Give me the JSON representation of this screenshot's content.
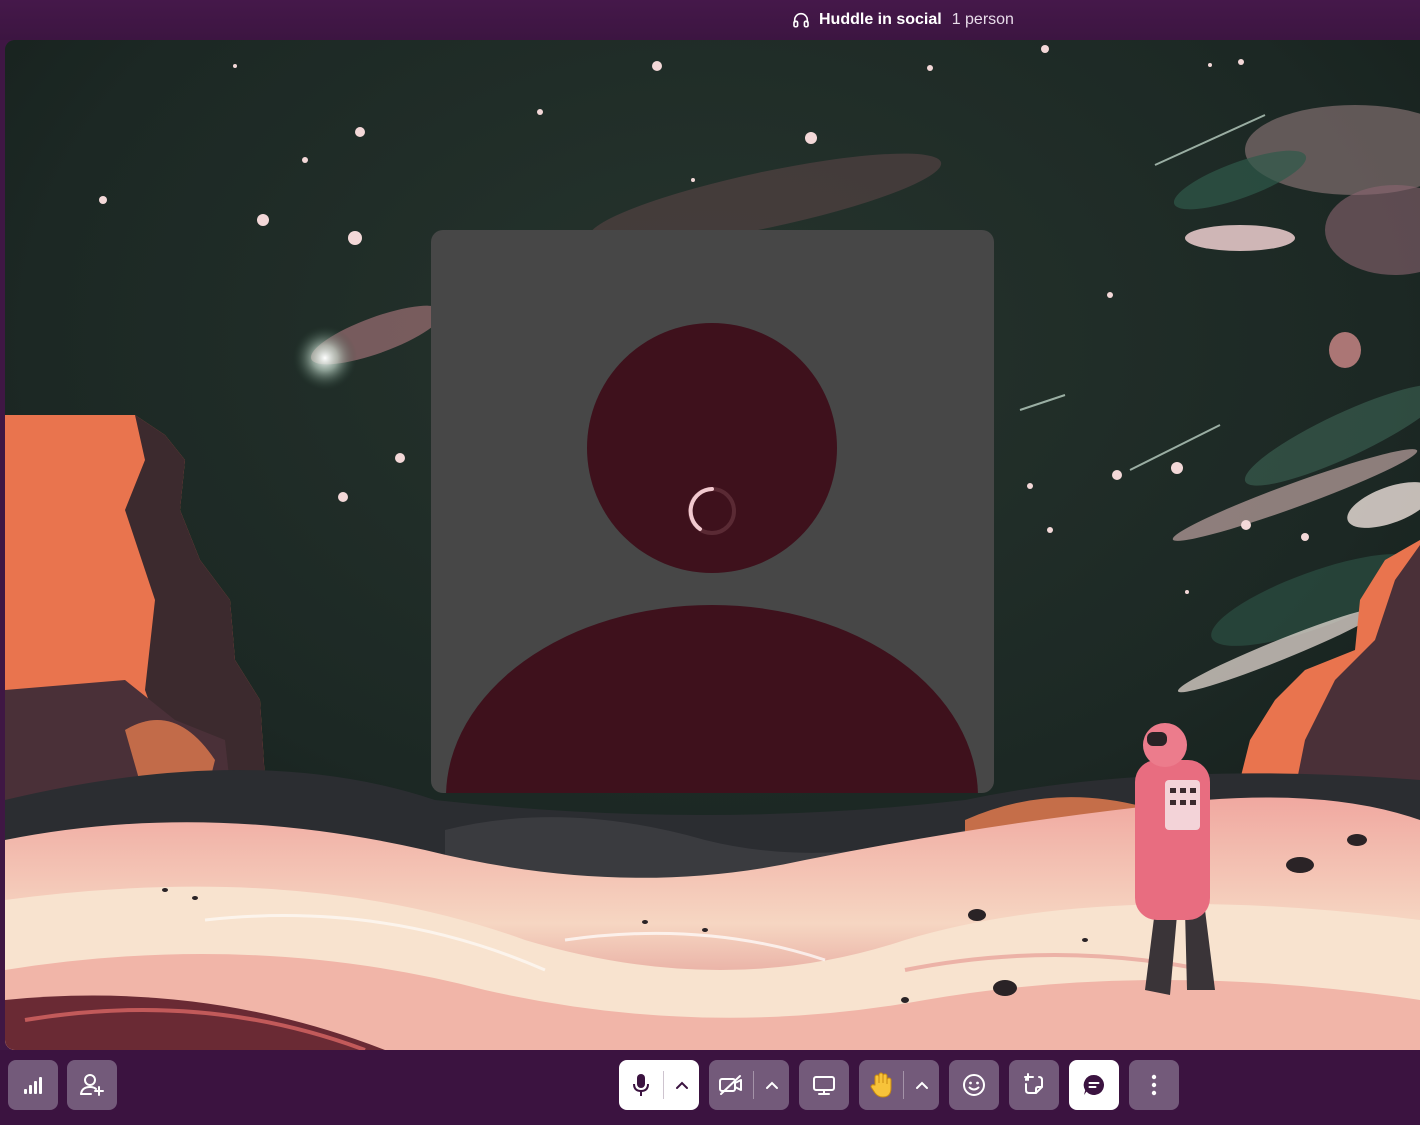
{
  "huddle": {
    "icon": "headphones-icon",
    "title": "Huddle in social",
    "participant_count": "1 person"
  },
  "participant": {
    "avatar": "generic-person-silhouette",
    "state": "loading"
  },
  "background": {
    "theme": "space-landscape-astronaut"
  },
  "toolbar": {
    "left": [
      "signal-bars-icon",
      "add-person-icon"
    ],
    "center": [
      {
        "name": "microphone",
        "icon": "microphone-icon",
        "state": "on",
        "has_menu": true
      },
      {
        "name": "camera",
        "icon": "video-off-icon",
        "state": "off",
        "has_menu": true
      },
      {
        "name": "share-screen",
        "icon": "monitor-icon"
      },
      {
        "name": "raise-hand",
        "icon": "raised-hand-icon",
        "has_menu": true
      },
      {
        "name": "reactions",
        "icon": "smiley-icon"
      },
      {
        "name": "sticker",
        "icon": "sticker-icon"
      },
      {
        "name": "thread",
        "icon": "chat-bubble-icon",
        "state": "active"
      },
      {
        "name": "more",
        "icon": "more-vertical-icon"
      }
    ]
  },
  "colors": {
    "window_frame": "#3f1744",
    "toolbar_button": "#735a7a",
    "tile_background": "#474747",
    "avatar": "#3e111c",
    "active_button": "#ffffff"
  }
}
